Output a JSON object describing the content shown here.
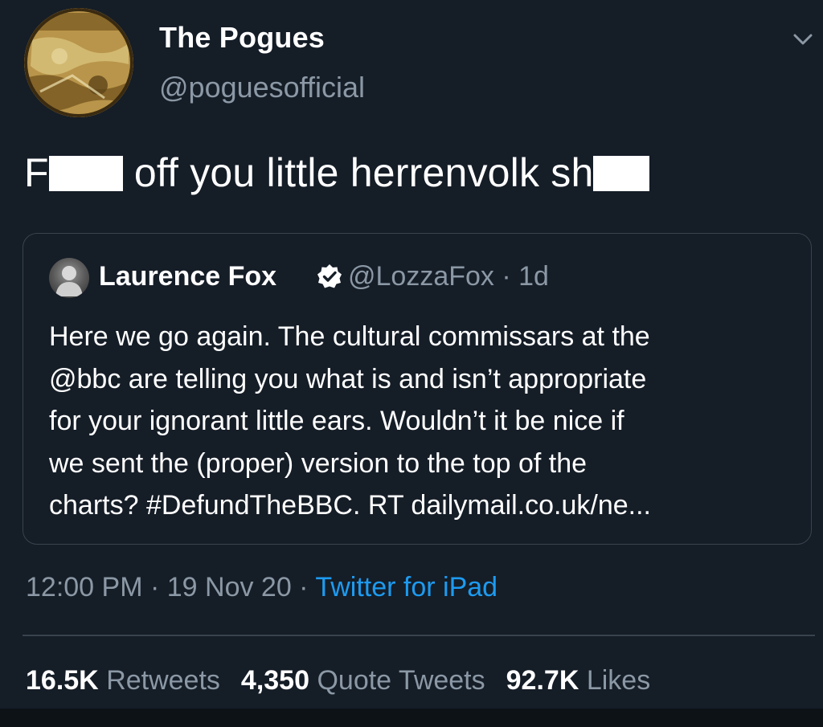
{
  "author": {
    "display_name": "The Pogues",
    "handle": "@poguesofficial",
    "avatar_icon": "album-cover-avatar"
  },
  "tweet": {
    "text_part1": "F",
    "text_part2": "off you little herrenvolk sh"
  },
  "quoted_tweet": {
    "display_name": "Laurence Fox",
    "verified_icon": "verified-badge-icon",
    "handle_time": "@LozzaFox · 1d",
    "lines": [
      "Here we go again. The cultural commissars at the",
      "@bbc are telling you what is and isn’t appropriate",
      "for your ignorant little ears. Wouldn’t it be nice if",
      "we sent the (proper) version to the top of the",
      "charts? #DefundTheBBC. RT dailymail.co.uk/ne..."
    ]
  },
  "meta": {
    "time_date": "12:00 PM · 19 Nov 20 · ",
    "source": "Twitter for iPad"
  },
  "stats": {
    "retweets_count": "16.5K",
    "retweets_label": "Retweets",
    "quotes_count": "4,350",
    "quotes_label": "Quote Tweets",
    "likes_count": "92.7K",
    "likes_label": "Likes"
  },
  "colors": {
    "background": "#151d27",
    "secondary_text": "#8b98a5",
    "link": "#1d9bf0",
    "border": "#38444d"
  }
}
